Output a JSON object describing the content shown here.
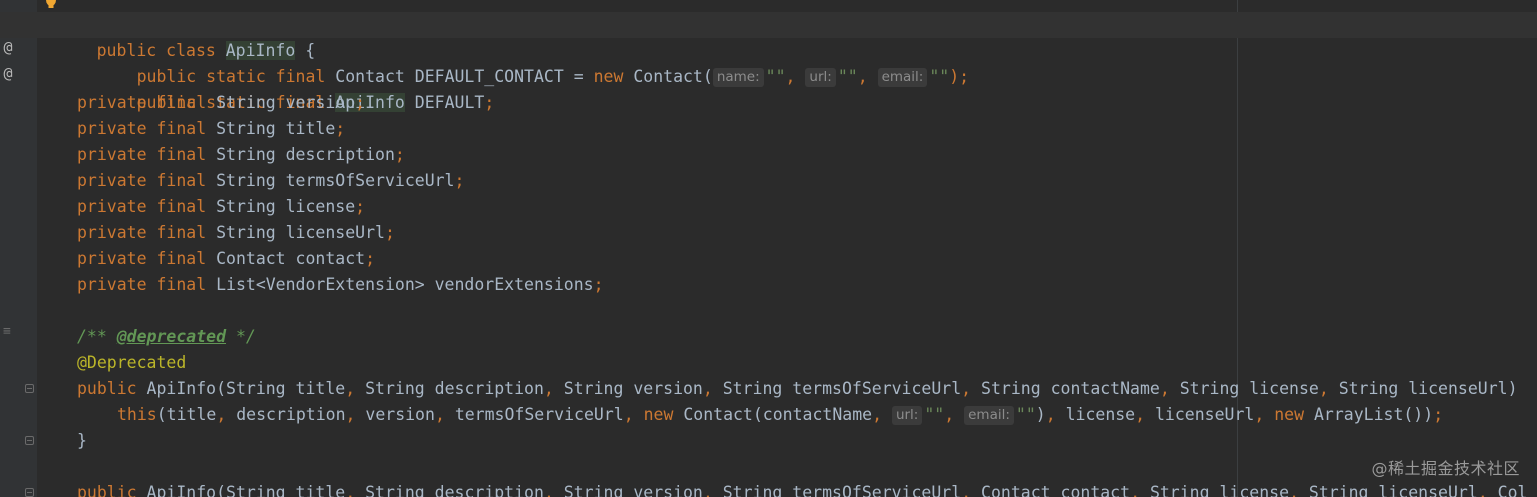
{
  "editor": {
    "lines": {
      "l1": {
        "kw": "public class ",
        "cls": "ApiInfo",
        "rest": " {"
      },
      "l2": {
        "kw1": "public static final ",
        "type": "Contact DEFAULT_CONTACT = ",
        "kw2": "new ",
        "ctor": "Contact(",
        "hint1": "name:",
        "s1": "\"\"",
        "c1": ", ",
        "hint2": "url:",
        "s2": "\"\"",
        "c2": ", ",
        "hint3": "email:",
        "s3": "\"\"",
        "end": ");"
      },
      "l3": {
        "kw1": "public static final ",
        "cls": "ApiInfo",
        "rest": " DEFAULT",
        "semi": ";"
      },
      "l4": {
        "kw": "private final ",
        "rest": "String version",
        "semi": ";"
      },
      "l5": {
        "kw": "private final ",
        "rest": "String title",
        "semi": ";"
      },
      "l6": {
        "kw": "private final ",
        "rest": "String description",
        "semi": ";"
      },
      "l7": {
        "kw": "private final ",
        "rest": "String termsOfServiceUrl",
        "semi": ";"
      },
      "l8": {
        "kw": "private final ",
        "rest": "String license",
        "semi": ";"
      },
      "l9": {
        "kw": "private final ",
        "rest": "String licenseUrl",
        "semi": ";"
      },
      "l10": {
        "kw": "private final ",
        "rest": "Contact contact",
        "semi": ";"
      },
      "l11": {
        "kw": "private final ",
        "rest": "List<VendorExtension> vendorExtensions",
        "semi": ";"
      },
      "l13": {
        "open": "/** ",
        "tag": "@deprecated",
        "close": " */"
      },
      "l14": {
        "ann": "@Deprecated"
      },
      "l15": {
        "kw": "public ",
        "p1": "ApiInfo(String title",
        "c1": ", ",
        "p2": "String description",
        "c2": ", ",
        "p3": "String version",
        "c3": ", ",
        "p4": "String termsOfServiceUrl",
        "c4": ", ",
        "p5": "String contactName",
        "c5": ", ",
        "p6": "String license",
        "c6": ", ",
        "p7": "String licenseUrl)"
      },
      "l16": {
        "kw1": "this",
        "a1": "(title",
        "c1": ", ",
        "a2": "description",
        "c2": ", ",
        "a3": "version",
        "c3": ", ",
        "a4": "termsOfServiceUrl",
        "c4": ", ",
        "kw2": "new ",
        "a5": "Contact(contactName",
        "c5": ", ",
        "hint1": "url:",
        "s1": "\"\"",
        "c6": ", ",
        "hint2": "email:",
        "s2": "\"\"",
        "a6": ")",
        "c7": ", ",
        "a7": "license",
        "c8": ", ",
        "a8": "licenseUrl",
        "c9": ", ",
        "kw3": "new ",
        "a9": "ArrayList())",
        "semi": ";"
      },
      "l17": {
        "brace": "}"
      },
      "l19": {
        "kw": "public ",
        "p1": "ApiInfo(String title",
        "c1": ", ",
        "p2": "String description",
        "c2": ", ",
        "p3": "String version",
        "c3": ", ",
        "p4": "String termsOfServiceUrl",
        "c4": ", ",
        "p5": "Contact contact",
        "c5": ", ",
        "p6": "String license",
        "c6": ", ",
        "p7": "String licenseUrl",
        "c7": ", ",
        "p8": "Col"
      }
    },
    "gutter": {
      "override_mark": "@",
      "doc_mark": "≡"
    }
  },
  "watermark": "@稀土掘金技术社区",
  "colors": {
    "background": "#2b2b2b",
    "keyword": "#cc7832",
    "string": "#6a8759",
    "doc_comment": "#629755",
    "annotation": "#bbb529",
    "text": "#a9b7c6"
  }
}
